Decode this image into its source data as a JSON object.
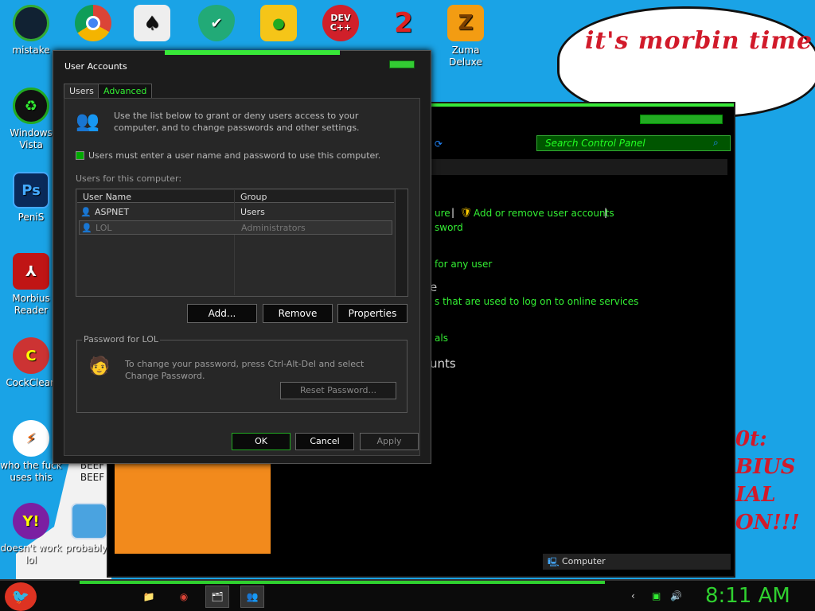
{
  "desktop": {
    "icons": [
      {
        "label": "mistake"
      },
      {
        "label": "Windows Vista"
      },
      {
        "label": "PeniS"
      },
      {
        "label": "Morbius Reader"
      },
      {
        "label": "CockClean"
      },
      {
        "label": "who the fuck uses this"
      },
      {
        "label": "doesn't work lol"
      },
      {
        "label": "Zuma Deluxe"
      },
      {
        "label": "BEEF BEEF"
      },
      {
        "label": "probably a rogu"
      }
    ],
    "cloud_text": "it's morbin time",
    "scribble_lines": [
      "0t:",
      "BIUS",
      "IAL",
      "ON!!!"
    ]
  },
  "control_panel": {
    "search_placeholder": "Search Control Panel",
    "links": [
      "ure",
      "Add or remove user accounts",
      "sword",
      "for any user",
      "s that are used to log on to online services",
      "als"
    ],
    "section_fragments": [
      "e",
      "unts"
    ],
    "status_computer": "Computer"
  },
  "dialog": {
    "title": "User Accounts",
    "tabs": [
      "Users",
      "Advanced"
    ],
    "intro": "Use the list below to grant or deny users access to your computer, and to change passwords and other settings.",
    "require_password_label": "Users must enter a user name and password to use this computer.",
    "users_label": "Users for this computer:",
    "columns": [
      "User Name",
      "Group"
    ],
    "rows": [
      {
        "name": "ASPNET",
        "group": "Users"
      },
      {
        "name": "LOL",
        "group": "Administrators"
      }
    ],
    "buttons": {
      "add": "Add...",
      "remove": "Remove",
      "properties": "Properties"
    },
    "password_group": {
      "legend": "Password for LOL",
      "text": "To change your password, press Ctrl-Alt-Del and select Change Password.",
      "reset": "Reset Password..."
    },
    "footer": {
      "ok": "OK",
      "cancel": "Cancel",
      "apply": "Apply"
    }
  },
  "taskbar": {
    "clock": "8:11 AM"
  }
}
